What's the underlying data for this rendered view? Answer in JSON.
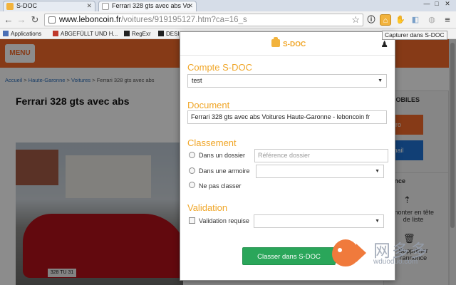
{
  "browser": {
    "tabs": [
      {
        "title": "S-DOC",
        "active": false
      },
      {
        "title": "Ferrari 328 gts avec abs Vo",
        "active": true
      }
    ],
    "window_buttons": [
      "—",
      "□",
      "✕"
    ],
    "url_host": "www.leboncoin.fr",
    "url_path": "/voitures/919195127.htm?ca=16_s",
    "tooltip": "Capturer dans S-DOC",
    "bookmarks": [
      {
        "label": "Applications",
        "icon": "apps-icon",
        "color": "#4a6fb5"
      },
      {
        "label": "ABGEFÜLLT UND H...",
        "icon": "xv-icon",
        "color": "#c0392b"
      },
      {
        "label": "RegExr",
        "icon": "regexr-icon",
        "color": "#222222"
      },
      {
        "label": "DESI",
        "icon": "a-icon",
        "color": "#222222"
      }
    ]
  },
  "page": {
    "menu_label": "MENU",
    "breadcrumb": [
      "Accueil",
      "Haute-Garonne",
      "Voitures",
      "Ferrari 328 gts avec abs"
    ],
    "breadcrumb_sep": " > ",
    "title": "Ferrari 328 gts avec abs",
    "plate": "328 TU 31",
    "side": {
      "box_title": "MOBILES",
      "btn1": "éro",
      "btn2": "mail",
      "box2_title": "once",
      "action1": "monter en tête de liste",
      "action2": "Supprimer l'annonce"
    },
    "accent": "#f56b2a"
  },
  "popup": {
    "logo_text": "S-DOC",
    "compte": {
      "heading": "Compte S-DOC",
      "value": "test"
    },
    "document": {
      "heading": "Document",
      "value": "Ferrari 328 gts avec abs Voitures Haute-Garonne - leboncoin fr"
    },
    "classement": {
      "heading": "Classement",
      "options": [
        "Dans un dossier",
        "Dans une armoire",
        "Ne pas classer"
      ],
      "dossier_placeholder": "Référence dossier",
      "armoire_value": ""
    },
    "validation": {
      "heading": "Validation",
      "checkbox_label": "Validation requise",
      "value": ""
    },
    "submit_label": "Classer dans S-DOC",
    "colors": {
      "heading": "#f0a628",
      "submit": "#2aa65a"
    }
  },
  "watermark": {
    "text": "网多多",
    "url": "wduoduo.com"
  }
}
